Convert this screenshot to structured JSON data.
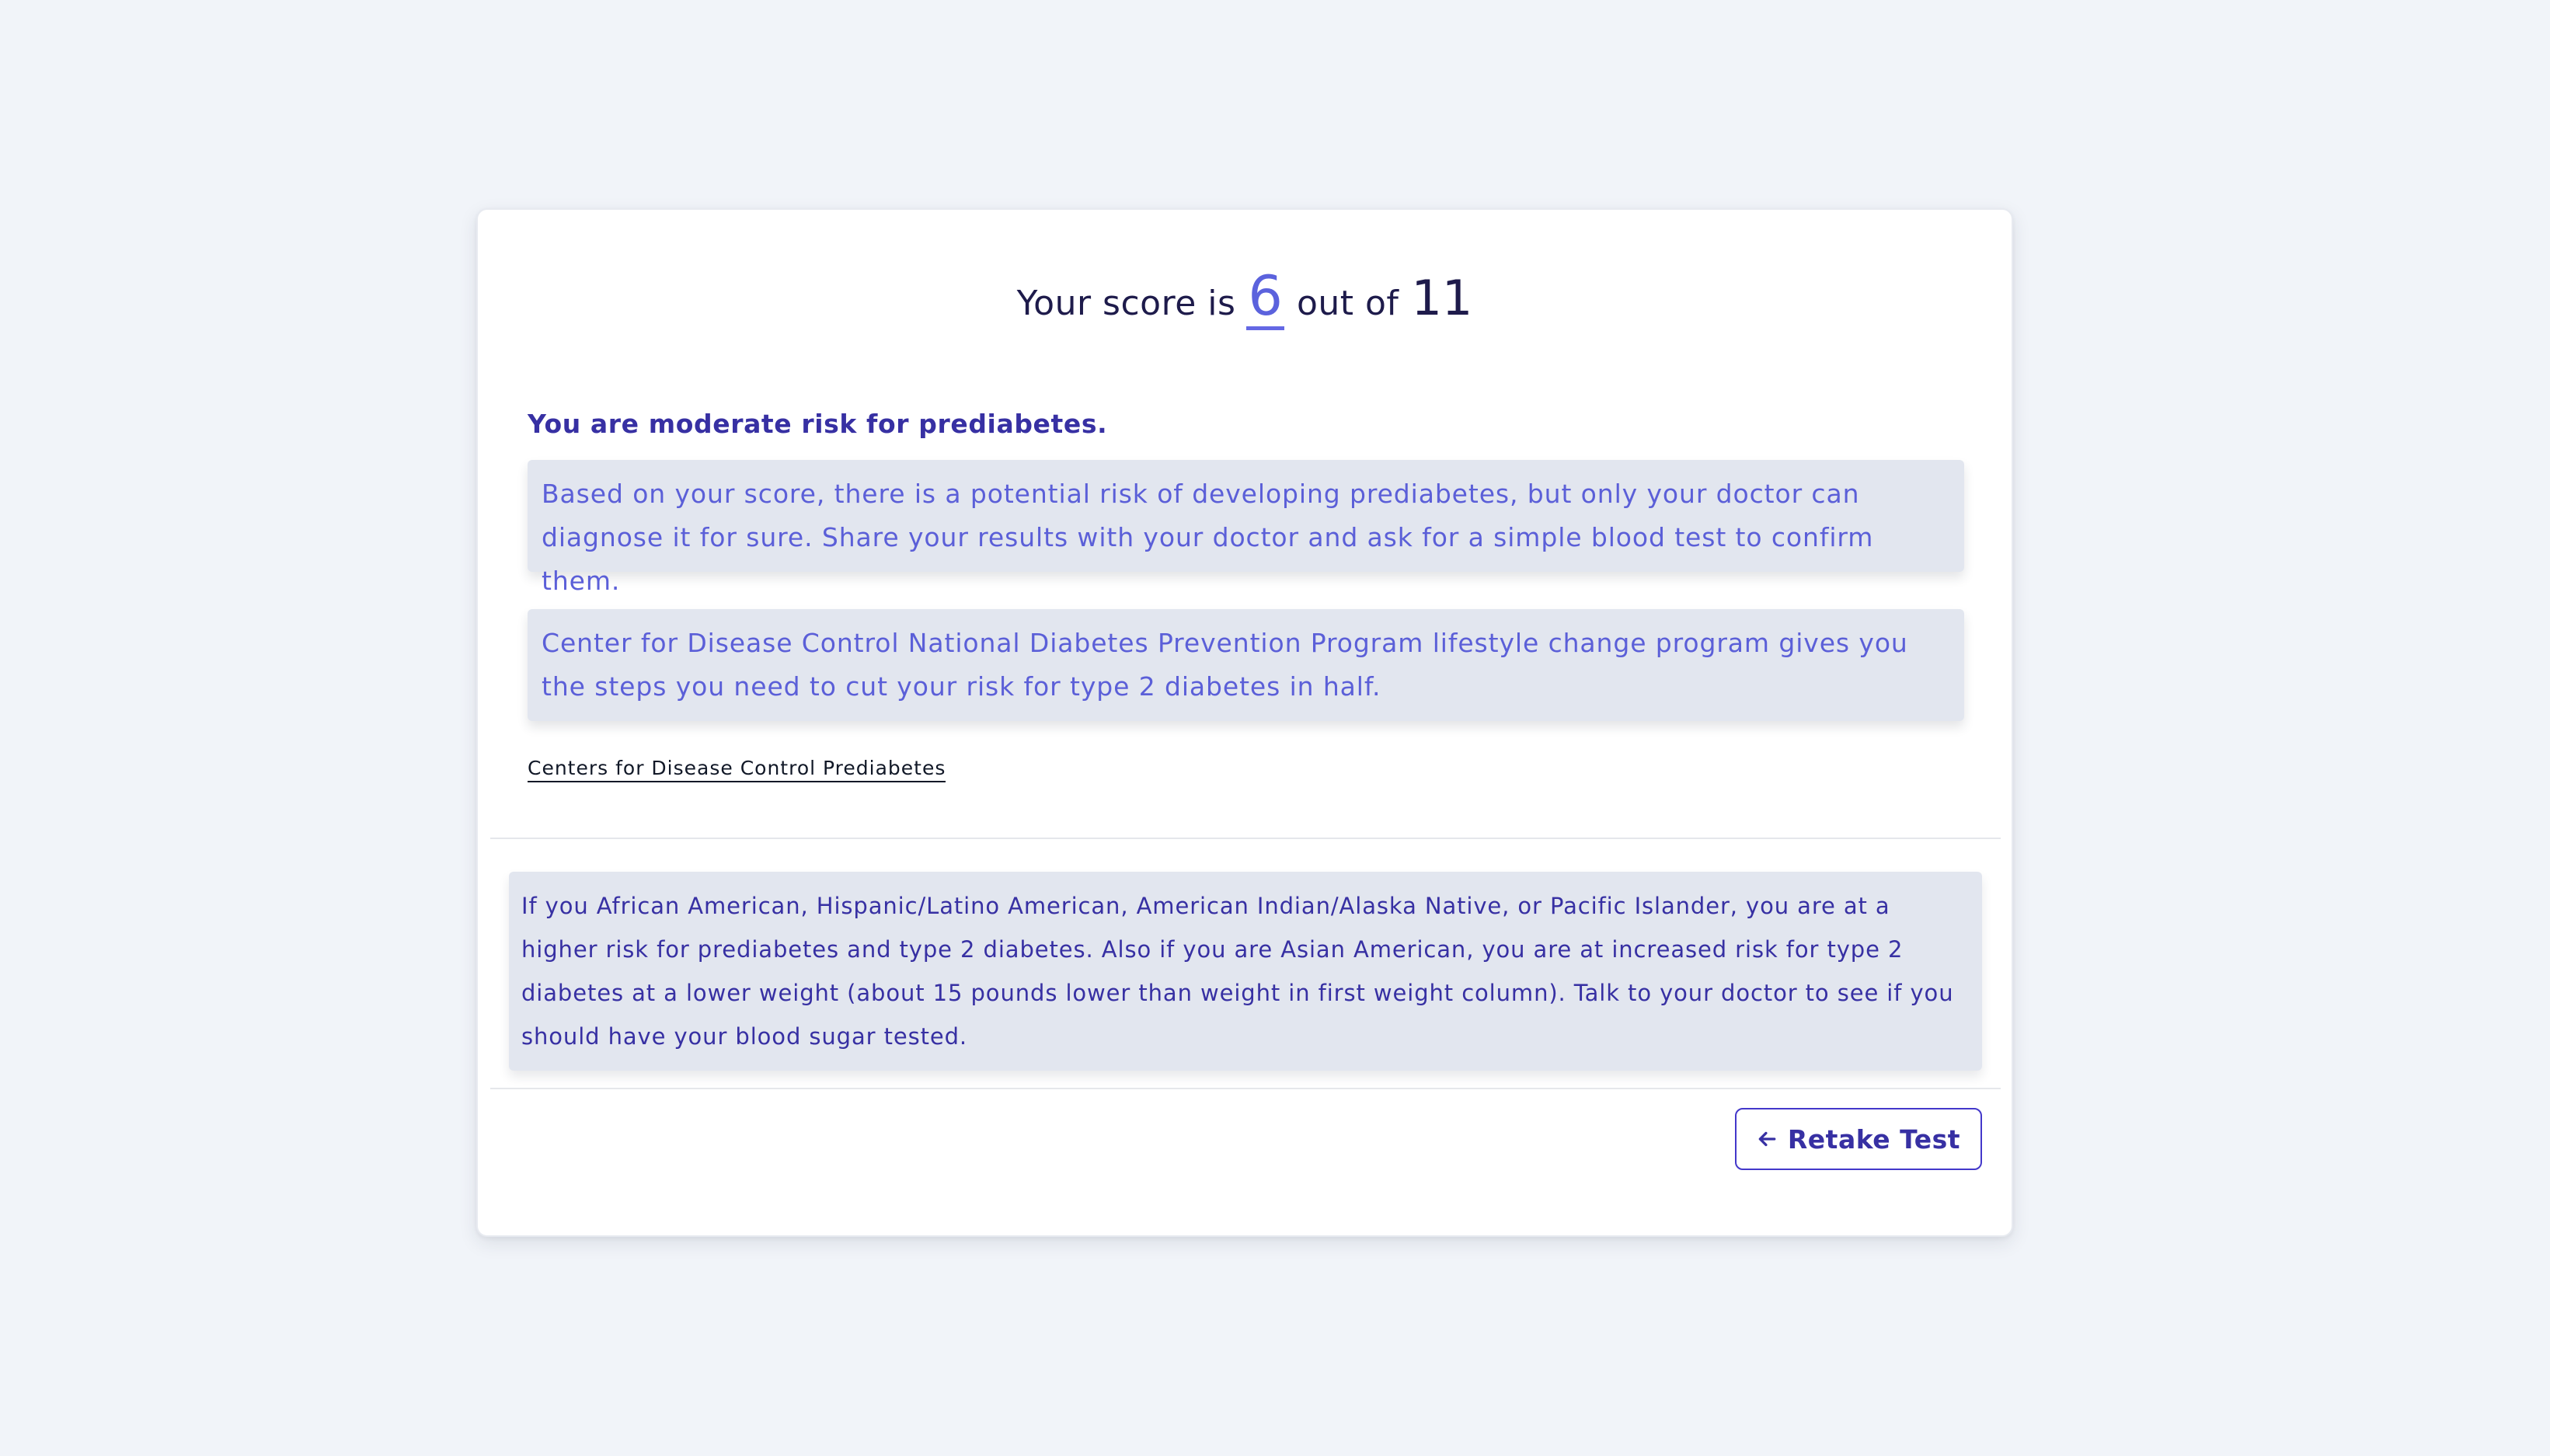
{
  "score": {
    "prefix": "Your score is",
    "value": "6",
    "middle": "out of",
    "max": "11"
  },
  "result": {
    "heading": "You are moderate risk for prediabetes.",
    "advice": "Based on your score, there is a potential risk of developing prediabetes, but only your doctor can diagnose it for sure. Share your results with your doctor and ask for a simple blood test to confirm them.",
    "program": "Center for Disease Control National Diabetes Prevention Program lifestyle change program gives you the steps you need to cut your risk for type 2 diabetes in half.",
    "link_label": "Centers for Disease Control Prediabetes"
  },
  "ethnicity_note": "If you African American, Hispanic/Latino American, American Indian/Alaska Native, or Pacific Islander, you are at a higher risk for prediabetes and type 2 diabetes. Also if you are Asian American, you are at increased risk for type 2 diabetes at a lower weight (about 15 pounds lower than weight in first weight column). Talk to your doctor to see if you should have your blood sugar tested.",
  "actions": {
    "retake_label": "Retake Test",
    "retake_icon": "arrow-left-icon"
  },
  "colors": {
    "accent": "#4338ca",
    "score_highlight": "#5b62dd",
    "box_background": "#e2e6ef",
    "page_background": "#f1f4f9"
  }
}
